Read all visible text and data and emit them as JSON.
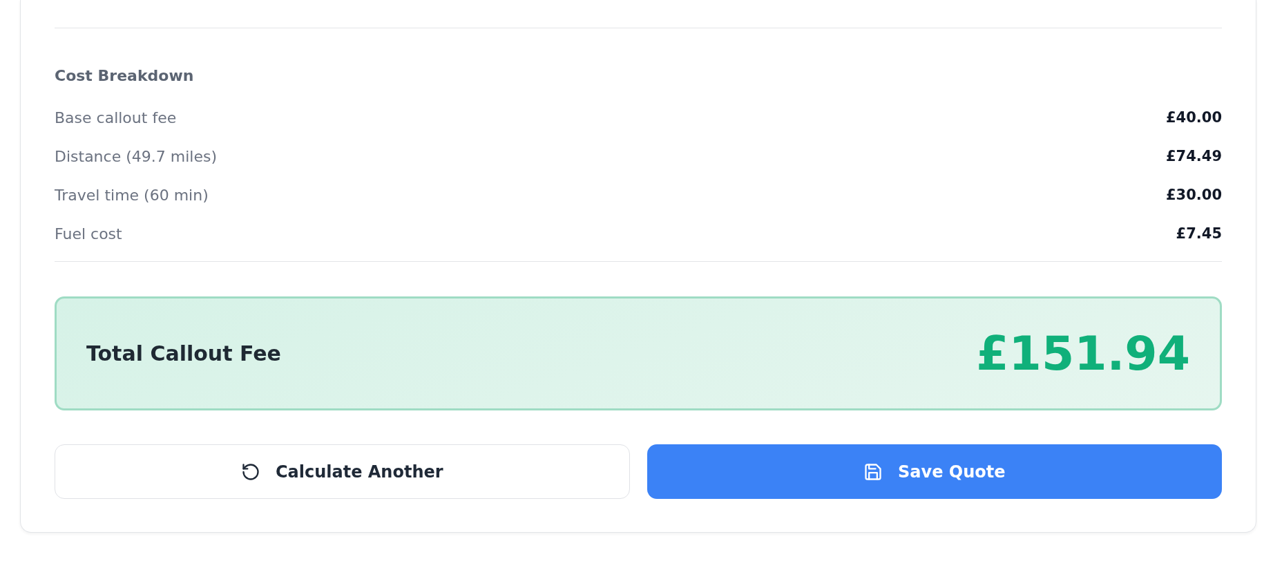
{
  "breakdown": {
    "title": "Cost Breakdown",
    "rows": [
      {
        "label": "Base callout fee",
        "amount": "£40.00"
      },
      {
        "label": "Distance (49.7 miles)",
        "amount": "£74.49"
      },
      {
        "label": "Travel time (60 min)",
        "amount": "£30.00"
      },
      {
        "label": "Fuel cost",
        "amount": "£7.45"
      }
    ]
  },
  "total": {
    "label": "Total Callout Fee",
    "amount": "£151.94"
  },
  "buttons": [
    {
      "label": "Calculate Another",
      "kind": "secondary"
    },
    {
      "label": "Save Quote",
      "kind": "primary"
    }
  ]
}
